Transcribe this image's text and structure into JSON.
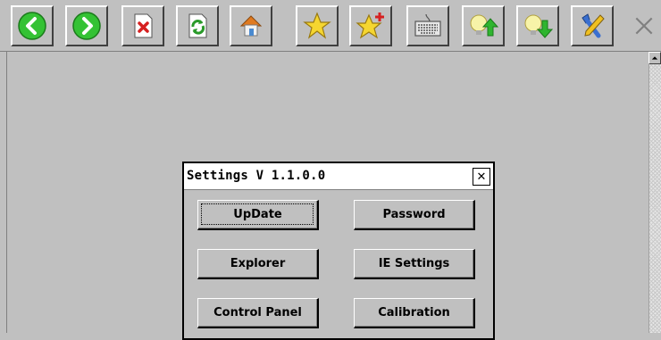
{
  "toolbar": {
    "buttons": [
      {
        "icon": "back-arrow-icon",
        "color": "#2fb52f"
      },
      {
        "icon": "forward-arrow-icon",
        "color": "#2fb52f"
      },
      {
        "icon": "stop-page-icon",
        "color": "#d62020"
      },
      {
        "icon": "refresh-page-icon",
        "color": "#2a9a2a"
      },
      {
        "icon": "home-icon",
        "color": "#e07a20"
      },
      {
        "icon": "favorites-star-icon",
        "color": "#f2d22a"
      },
      {
        "icon": "add-favorite-icon",
        "color": "#f2d22a"
      },
      {
        "icon": "keyboard-icon",
        "color": "#707070"
      },
      {
        "icon": "brightness-up-icon",
        "color": "#2fb52f"
      },
      {
        "icon": "brightness-down-icon",
        "color": "#2fb52f"
      },
      {
        "icon": "tools-settings-icon",
        "color": "#3a6fd0"
      }
    ],
    "close_icon": "close-icon"
  },
  "dialog": {
    "title": "Settings V 1.1.0.0",
    "close_glyph": "✕",
    "buttons": {
      "update": "UpDate",
      "password": "Password",
      "explorer": "Explorer",
      "ie_settings": "IE Settings",
      "control_panel": "Control Panel",
      "calibration": "Calibration"
    }
  }
}
